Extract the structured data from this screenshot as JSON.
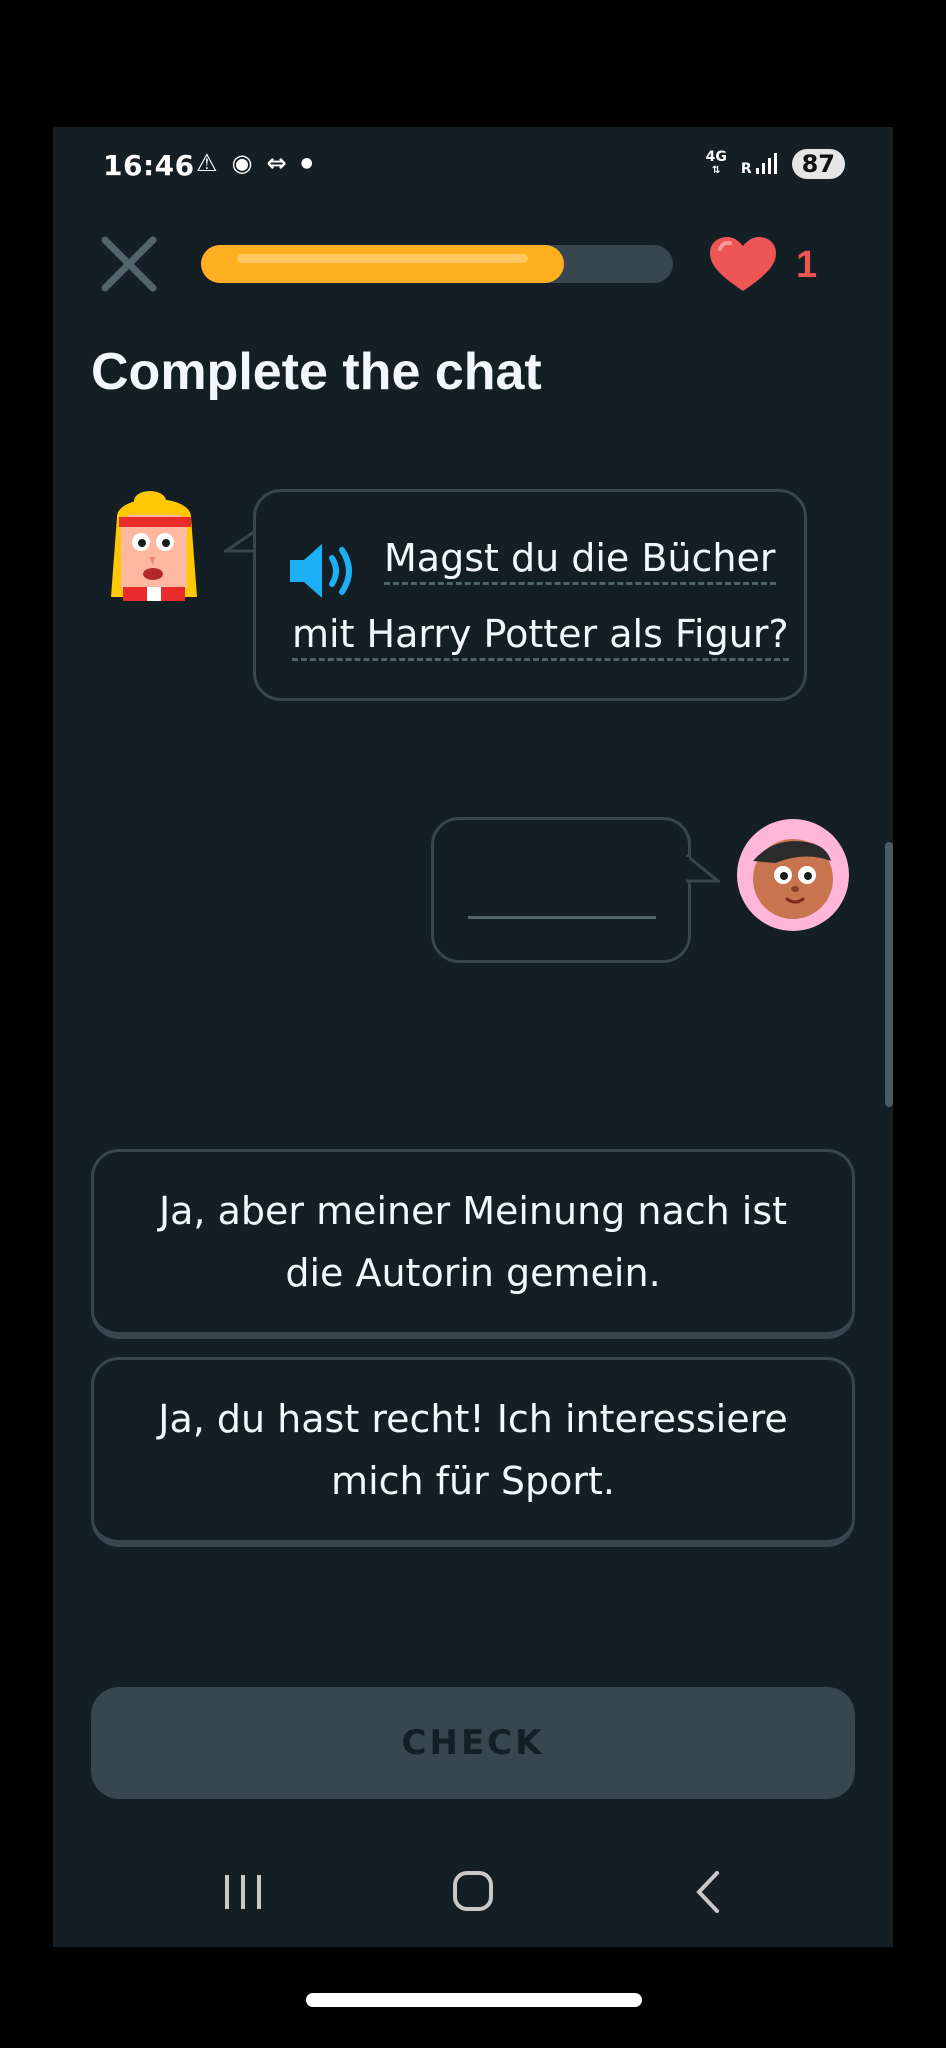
{
  "status_bar": {
    "time": "16:46",
    "notification_icons": [
      "warning-icon",
      "chrome-icon",
      "link-icon",
      "dot-icon"
    ],
    "network_top": "4G",
    "network_bottom": "R",
    "battery": "87"
  },
  "header": {
    "close_icon": "close-icon",
    "progress": 0.77,
    "progress_color": "#ffb020",
    "hearts_count": "1",
    "heart_color": "#ee5555"
  },
  "page_title": "Complete the chat",
  "chat": {
    "prompt_line1": "Magst du die Bücher",
    "prompt_line2": "mit Harry Potter als Figur?",
    "speaker_icon": "speaker-icon"
  },
  "options": [
    {
      "label": "Ja, aber meiner Meinung nach ist die Autorin gemein."
    },
    {
      "label": "Ja, du hast recht! Ich interessiere mich für Sport."
    }
  ],
  "check_label": "CHECK",
  "nav": {
    "recent_icon": "recent-apps-icon",
    "home_icon": "home-icon",
    "back_icon": "back-icon"
  },
  "colors": {
    "background": "#131f24",
    "border": "#37464f",
    "text": "#f1f7fb",
    "accent_blue": "#1cb0f6"
  }
}
